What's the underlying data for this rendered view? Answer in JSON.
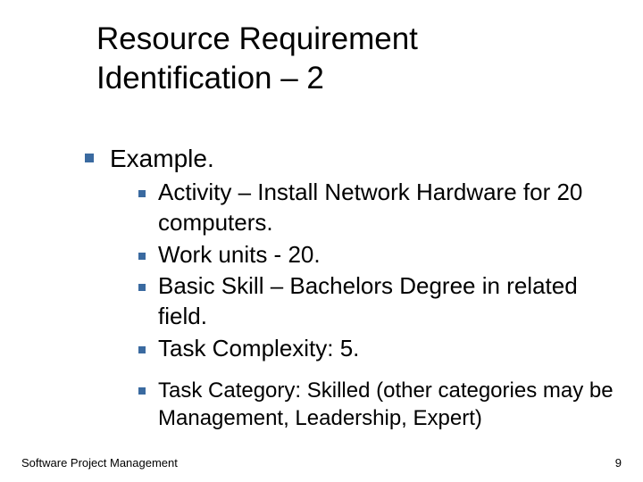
{
  "title": "Resource Requirement Identification – 2",
  "body": {
    "lead": "Example.",
    "items": [
      "Activity – Install Network Hardware for 20 computers.",
      "Work units - 20.",
      "Basic Skill – Bachelors Degree in related field.",
      "Task Complexity: 5."
    ],
    "extra": "Task Category: Skilled (other categories may be Management, Leadership, Expert)"
  },
  "footer": {
    "left": "Software Project Management",
    "right": "9"
  }
}
